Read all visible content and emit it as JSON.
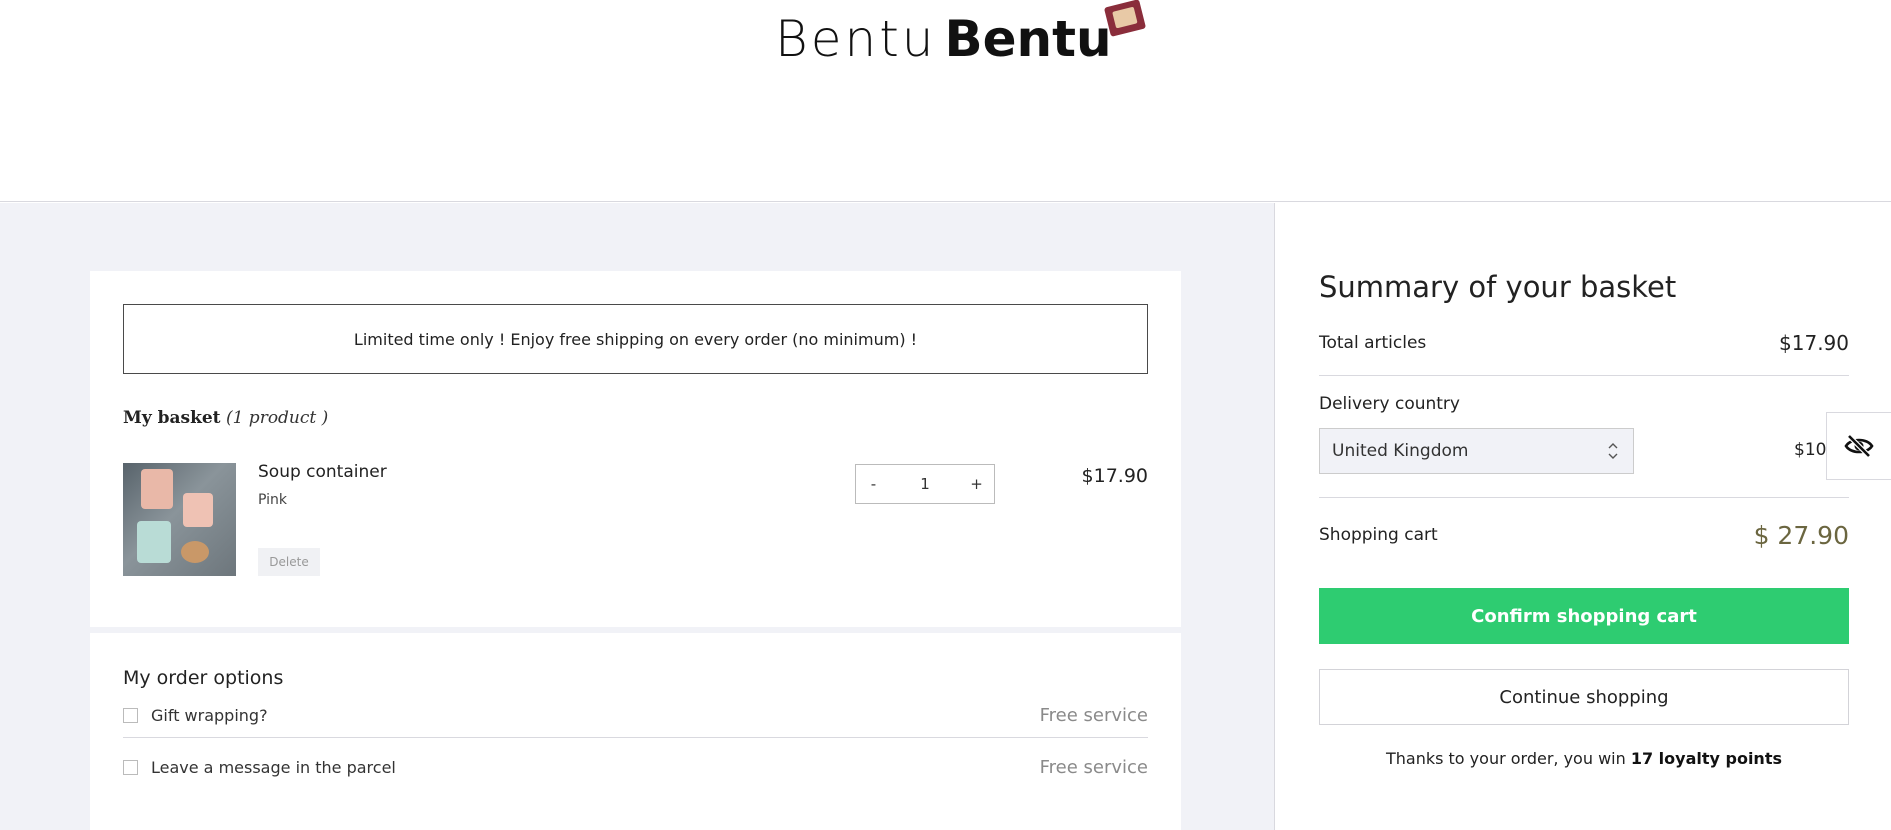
{
  "header": {
    "logo_text_light": "Bentu",
    "logo_text_bold": "Bentu"
  },
  "basket": {
    "promo_text": "Limited time only ! Enjoy free shipping on every order  (no minimum) !",
    "title": "My basket",
    "count": "(1 product )",
    "items": [
      {
        "name": "Soup container",
        "variant": "Pink",
        "delete_label": "Delete",
        "decrement_label": "-",
        "quantity": "1",
        "increment_label": "+",
        "price": "$17.90"
      }
    ]
  },
  "options": {
    "title": "My order options",
    "items": [
      {
        "label": "Gift wrapping?",
        "price": "Free service"
      },
      {
        "label": "Leave a message in the parcel",
        "price": "Free service"
      }
    ]
  },
  "summary": {
    "title": "Summary of your basket",
    "total_articles_label": "Total articles",
    "total_articles_value": "$17.90",
    "delivery_country_label": "Delivery country",
    "delivery_country_selected": "United Kingdom",
    "shipping_value_visible": "$10.",
    "shopping_cart_label": "Shopping cart",
    "shopping_cart_value": "$ 27.90",
    "confirm_label": "Confirm shopping cart",
    "continue_label": "Continue shopping",
    "loyalty_prefix": "Thanks to your order, you win ",
    "loyalty_points": "17 loyalty points"
  },
  "colors": {
    "confirm_button": "#2ecc71",
    "page_background": "#f1f2f7",
    "cart_total": "#6b6640"
  },
  "icons": {
    "floating_widget": "eye-slash-icon",
    "select_arrows": "chevron-up-down-icon",
    "logo_badge": "dice-badge-icon"
  }
}
